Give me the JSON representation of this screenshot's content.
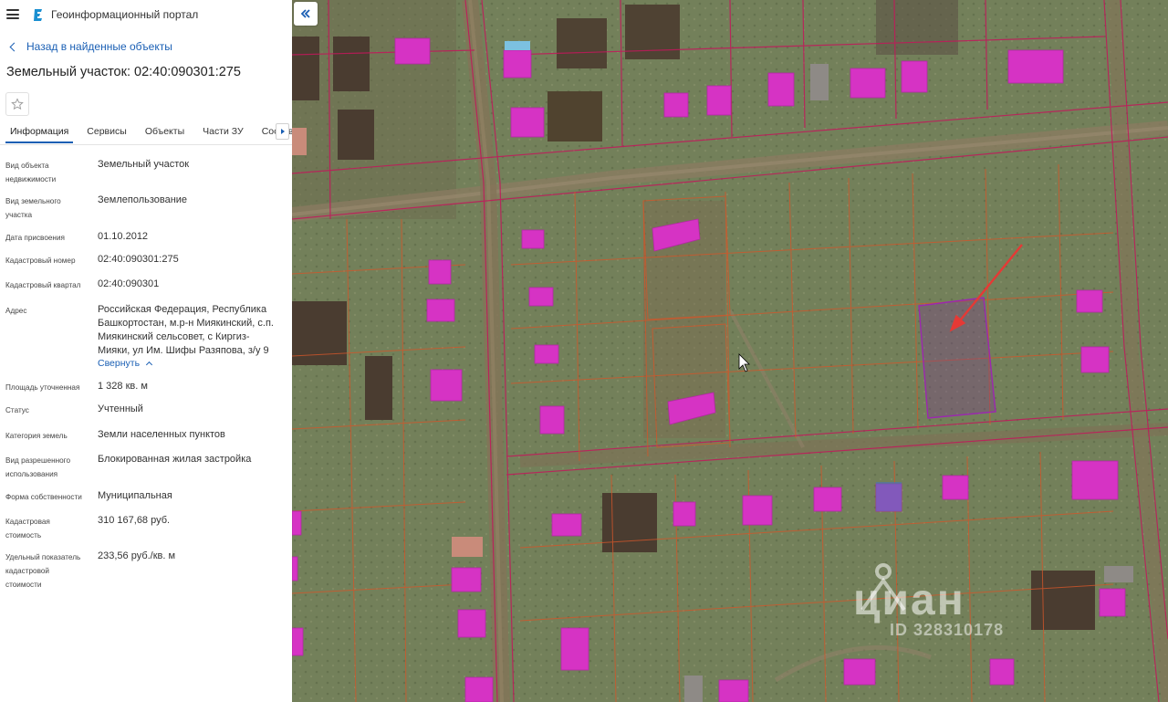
{
  "app": {
    "title": "Геоинформационный портал"
  },
  "nav": {
    "back_label": "Назад в найденные объекты"
  },
  "object": {
    "title": "Земельный участок: 02:40:090301:275"
  },
  "tabs": [
    {
      "label": "Информация",
      "active": true
    },
    {
      "label": "Сервисы"
    },
    {
      "label": "Объекты"
    },
    {
      "label": "Части ЗУ"
    },
    {
      "label": "Состав"
    }
  ],
  "info": {
    "object_type": {
      "label_1": "Вид объекта",
      "label_2": "недвижимости",
      "value": "Земельный участок"
    },
    "land_type": {
      "label_1": "Вид земельного",
      "label_2": "участка",
      "value": "Землепользование"
    },
    "assign_date": {
      "label": "Дата присвоения",
      "value": "01.10.2012"
    },
    "cadastral_number": {
      "label": "Кадастровый номер",
      "value": "02:40:090301:275"
    },
    "cadastral_quarter": {
      "label": "Кадастровый квартал",
      "value": "02:40:090301"
    },
    "address": {
      "label": "Адрес",
      "line_1": "Российская Федерация, Республика",
      "line_2": "Башкортостан, м.р-н Миякинский, с.п.",
      "line_3": "Миякинский сельсовет, с Киргиз-",
      "line_4": "Мияки, ул Им. Шифы Разяпова, з/у 9",
      "collapse_label": "Свернуть"
    },
    "area": {
      "label": "Площадь уточненная",
      "value": "1 328 кв. м"
    },
    "status": {
      "label": "Статус",
      "value": "Учтенный"
    },
    "land_category": {
      "label": "Категория земель",
      "value": "Земли населенных пунктов"
    },
    "permitted_use": {
      "label_1": "Вид разрешенного",
      "label_2": "использования",
      "value": "Блокированная жилая застройка"
    },
    "ownership": {
      "label": "Форма собственности",
      "value": "Муниципальная"
    },
    "cadastral_value": {
      "label_1": "Кадастровая",
      "label_2": "стоимость",
      "value": "310 167,68 руб."
    },
    "specific_value": {
      "label_1": "Удельный показатель",
      "label_2": "кадастровой",
      "label_3": "стоимости",
      "value": "233,56 руб./кв. м"
    }
  },
  "map": {
    "watermark": "циан",
    "watermark_id": "ID 328310178",
    "colors": {
      "parcel_border": "#c2185b",
      "building": "#d633c4",
      "highlight": "#7a3a8c",
      "arrow": "#e53935"
    }
  }
}
